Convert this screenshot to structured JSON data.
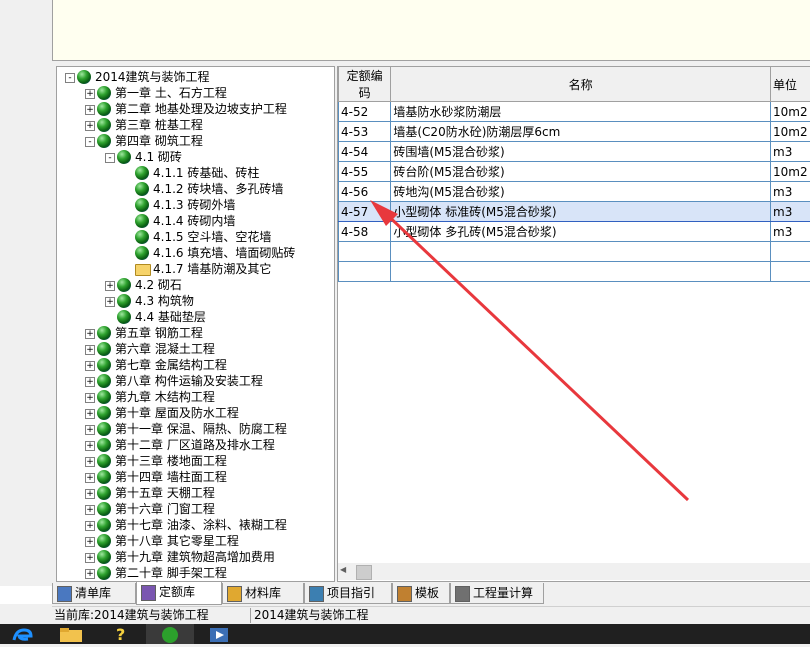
{
  "tree": {
    "items": [
      {
        "label": "2014建筑与装饰工程",
        "level": 0,
        "expander": "-",
        "icon": "globe"
      },
      {
        "label": "第一章 土、石方工程",
        "level": 1,
        "expander": "+",
        "icon": "globe"
      },
      {
        "label": "第二章 地基处理及边坡支护工程",
        "level": 1,
        "expander": "+",
        "icon": "globe"
      },
      {
        "label": "第三章 桩基工程",
        "level": 1,
        "expander": "+",
        "icon": "globe"
      },
      {
        "label": "第四章 砌筑工程",
        "level": 1,
        "expander": "-",
        "icon": "globe"
      },
      {
        "label": "4.1  砌砖",
        "level": 2,
        "expander": "-",
        "icon": "globe"
      },
      {
        "label": "4.1.1  砖基础、砖柱",
        "level": 3,
        "expander": "",
        "icon": "globe"
      },
      {
        "label": "4.1.2  砖块墙、多孔砖墙",
        "level": 3,
        "expander": "",
        "icon": "globe"
      },
      {
        "label": "4.1.3  砖砌外墙",
        "level": 3,
        "expander": "",
        "icon": "globe"
      },
      {
        "label": "4.1.4  砖砌内墙",
        "level": 3,
        "expander": "",
        "icon": "globe"
      },
      {
        "label": "4.1.5  空斗墙、空花墙",
        "level": 3,
        "expander": "",
        "icon": "globe"
      },
      {
        "label": "4.1.6  填充墙、墙面砌贴砖",
        "level": 3,
        "expander": "",
        "icon": "globe"
      },
      {
        "label": "4.1.7  墙基防潮及其它",
        "level": 3,
        "expander": "",
        "icon": "folder"
      },
      {
        "label": "4.2  砌石",
        "level": 2,
        "expander": "+",
        "icon": "globe"
      },
      {
        "label": "4.3  构筑物",
        "level": 2,
        "expander": "+",
        "icon": "globe"
      },
      {
        "label": "4.4  基础垫层",
        "level": 2,
        "expander": "",
        "icon": "globe"
      },
      {
        "label": "第五章 钢筋工程",
        "level": 1,
        "expander": "+",
        "icon": "globe"
      },
      {
        "label": "第六章 混凝土工程",
        "level": 1,
        "expander": "+",
        "icon": "globe"
      },
      {
        "label": "第七章 金属结构工程",
        "level": 1,
        "expander": "+",
        "icon": "globe"
      },
      {
        "label": "第八章 构件运输及安装工程",
        "level": 1,
        "expander": "+",
        "icon": "globe"
      },
      {
        "label": "第九章 木结构工程",
        "level": 1,
        "expander": "+",
        "icon": "globe"
      },
      {
        "label": "第十章 屋面及防水工程",
        "level": 1,
        "expander": "+",
        "icon": "globe"
      },
      {
        "label": "第十一章 保温、隔热、防腐工程",
        "level": 1,
        "expander": "+",
        "icon": "globe"
      },
      {
        "label": "第十二章 厂区道路及排水工程",
        "level": 1,
        "expander": "+",
        "icon": "globe"
      },
      {
        "label": "第十三章 楼地面工程",
        "level": 1,
        "expander": "+",
        "icon": "globe"
      },
      {
        "label": "第十四章 墙柱面工程",
        "level": 1,
        "expander": "+",
        "icon": "globe"
      },
      {
        "label": "第十五章 天棚工程",
        "level": 1,
        "expander": "+",
        "icon": "globe"
      },
      {
        "label": "第十六章 门窗工程",
        "level": 1,
        "expander": "+",
        "icon": "globe"
      },
      {
        "label": "第十七章 油漆、涂料、裱糊工程",
        "level": 1,
        "expander": "+",
        "icon": "globe"
      },
      {
        "label": "第十八章 其它零星工程",
        "level": 1,
        "expander": "+",
        "icon": "globe"
      },
      {
        "label": "第十九章 建筑物超高增加费用",
        "level": 1,
        "expander": "+",
        "icon": "globe"
      },
      {
        "label": "第二十章 脚手架工程",
        "level": 1,
        "expander": "+",
        "icon": "globe"
      }
    ]
  },
  "grid": {
    "headers": {
      "code": "定额编码",
      "name": "名称",
      "unit": "单位"
    },
    "rows": [
      {
        "code": "4-52",
        "name": "墙基防水砂浆防潮层",
        "unit": "10m2",
        "selected": false
      },
      {
        "code": "4-53",
        "name": "墙基(C20防水砼)防潮层厚6cm",
        "unit": "10m2",
        "selected": false
      },
      {
        "code": "4-54",
        "name": "砖围墙(M5混合砂浆)",
        "unit": "m3",
        "selected": false
      },
      {
        "code": "4-55",
        "name": "砖台阶(M5混合砂浆)",
        "unit": "10m2",
        "selected": false
      },
      {
        "code": "4-56",
        "name": "砖地沟(M5混合砂浆)",
        "unit": "m3",
        "selected": false
      },
      {
        "code": "4-57",
        "name": "小型砌体 标准砖(M5混合砂浆)",
        "unit": "m3",
        "selected": true
      },
      {
        "code": "4-58",
        "name": "小型砌体 多孔砖(M5混合砂浆)",
        "unit": "m3",
        "selected": false
      },
      {
        "code": "",
        "name": "",
        "unit": "",
        "selected": false
      },
      {
        "code": "",
        "name": "",
        "unit": "",
        "selected": false
      }
    ]
  },
  "tabs": [
    {
      "label": "清单库",
      "icon": "list-icon",
      "active": false
    },
    {
      "label": "定额库",
      "icon": "quota-icon",
      "active": true
    },
    {
      "label": "材料库",
      "icon": "folder-icon",
      "active": false
    },
    {
      "label": "项目指引",
      "icon": "guide-icon",
      "active": false
    },
    {
      "label": "模板",
      "icon": "template-icon",
      "active": false
    },
    {
      "label": "工程量计算",
      "icon": "calc-icon",
      "active": false
    }
  ],
  "status": {
    "current_library": "当前库:2014建筑与装饰工程",
    "library_name": "2014建筑与装饰工程"
  },
  "colors": {
    "annotation_arrow": "#e8383d",
    "selection": "#d8e4f8",
    "top_panel": "#fffff0"
  }
}
